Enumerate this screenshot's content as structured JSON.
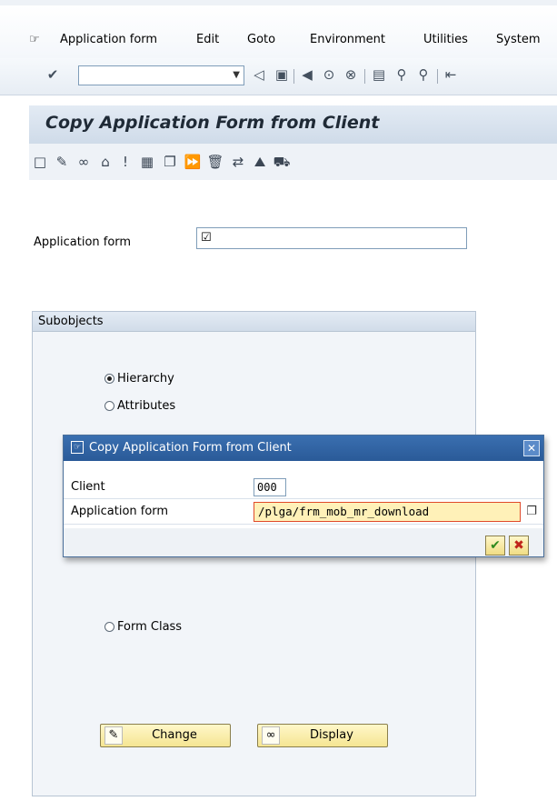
{
  "menubar": {
    "items": [
      {
        "label": "Application form"
      },
      {
        "label": "Edit"
      },
      {
        "label": "Goto"
      },
      {
        "label": "Environment"
      },
      {
        "label": "Utilities"
      },
      {
        "label": "System"
      }
    ]
  },
  "toolbar": {
    "command_value": ""
  },
  "page": {
    "title": "Copy Application Form from Client"
  },
  "main": {
    "appform_label": "Application form",
    "appform_value": "☑",
    "subobjects_title": "Subobjects",
    "radios": [
      {
        "label": "Hierarchy",
        "selected": true
      },
      {
        "label": "Attributes",
        "selected": false
      },
      {
        "label": "Form Class",
        "selected": false
      }
    ],
    "change_label": "Change",
    "display_label": "Display"
  },
  "dialog": {
    "title": "Copy Application Form from Client",
    "client_label": "Client",
    "client_value": "000",
    "form_label": "Application form",
    "form_value": "/plga/frm_mob_mr_download"
  }
}
